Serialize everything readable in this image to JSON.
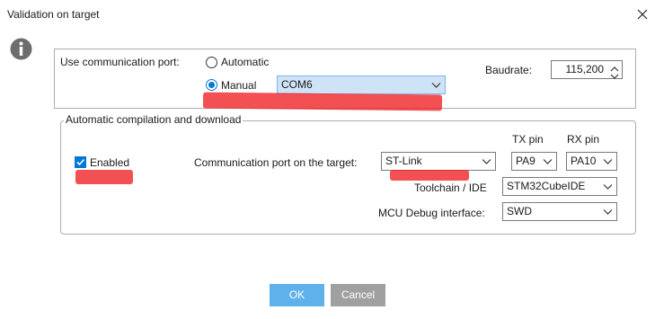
{
  "window": {
    "title": "Validation on target"
  },
  "icons": {
    "info": "info-icon",
    "close": "close-icon",
    "dropdown": "chevron-down-icon"
  },
  "port": {
    "label": "Use communication port:",
    "automatic_label": "Automatic",
    "manual_label": "Manual",
    "selected": "Manual",
    "com_value": "COM6",
    "baudrate_label": "Baudrate:",
    "baudrate_value": "115,200"
  },
  "compile": {
    "group_title": "Automatic compilation and download",
    "enabled_label": "Enabled",
    "enabled_checked": true,
    "comm_port_label": "Communication port on the target:",
    "comm_port_value": "ST-Link",
    "tx_label": "TX pin",
    "tx_value": "PA9",
    "rx_label": "RX pin",
    "rx_value": "PA10",
    "toolchain_label": "Toolchain / IDE",
    "toolchain_value": "STM32CubeIDE",
    "debug_label": "MCU Debug interface:",
    "debug_value": "SWD"
  },
  "buttons": {
    "ok": "OK",
    "cancel": "Cancel"
  },
  "colors": {
    "accent": "#0078d7",
    "annotation": "#ef1f24",
    "ok_button": "#5fb1ea",
    "cancel_button": "#a0a0a0"
  }
}
